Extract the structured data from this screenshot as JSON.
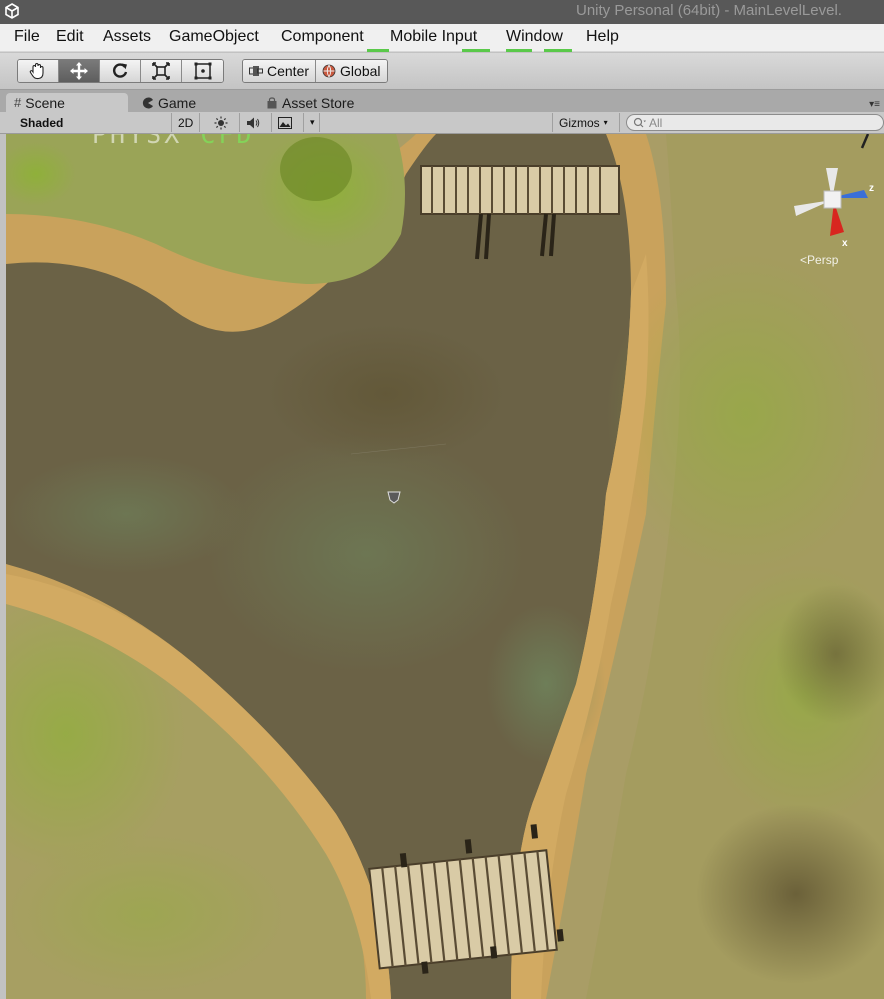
{
  "window": {
    "title": "Unity Personal (64bit) - MainLevelLevel."
  },
  "menu": [
    "File",
    "Edit",
    "Assets",
    "GameObject",
    "Component",
    "Mobile Input",
    "Window",
    "Help"
  ],
  "toolbar": {
    "tools": [
      "hand-tool",
      "move-tool",
      "rotate-tool",
      "scale-tool",
      "rect-tool"
    ],
    "active_tool": "move-tool",
    "pivot_mode": "Center",
    "pivot_rotation": "Global"
  },
  "tabs": [
    {
      "label": "Scene",
      "icon": "scene-grid-icon",
      "active": true
    },
    {
      "label": "Game",
      "icon": "game-pacman-icon",
      "active": false
    },
    {
      "label": "Asset Store",
      "icon": "asset-store-bag-icon",
      "active": false
    }
  ],
  "scene_toolbar": {
    "draw_mode": "Shaded",
    "mode_2d": "2D",
    "gizmos": "Gizmos",
    "search_placeholder": "All"
  },
  "scene": {
    "overlay_text_a": "PHYSX",
    "overlay_text_b": "CFD",
    "projection": "Persp",
    "axis_x": "x",
    "axis_z": "z"
  },
  "colors": {
    "accent_green": "#5ac94a",
    "water": "#6b6246",
    "grass": "#8da33e",
    "sand": "#c9a25c"
  }
}
